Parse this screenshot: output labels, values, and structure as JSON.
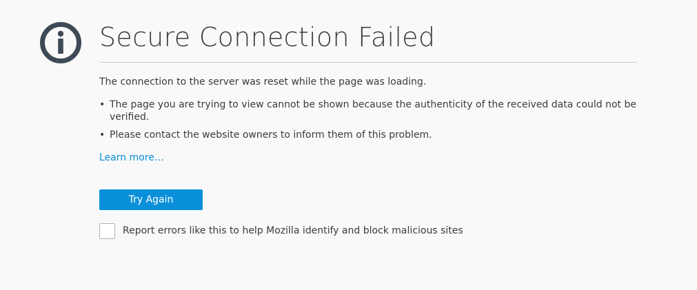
{
  "error_page": {
    "title": "Secure Connection Failed",
    "icon": "info-icon",
    "lead": "The connection to the server was reset while the page was loading.",
    "bullets": [
      "The page you are trying to view cannot be shown because the authenticity of the received data could not be verified.",
      "Please contact the website owners to inform them of this problem."
    ],
    "bullet_symbol": "•",
    "learn_more": "Learn more…",
    "try_again_label": "Try Again",
    "report_label": "Report errors like this to help Mozilla identify and block malicious sites",
    "report_checked": false
  },
  "colors": {
    "background": "#f9f9fa",
    "icon": "#3e4a56",
    "link": "#0a8dd8",
    "primary_button": "#0a90d9"
  }
}
